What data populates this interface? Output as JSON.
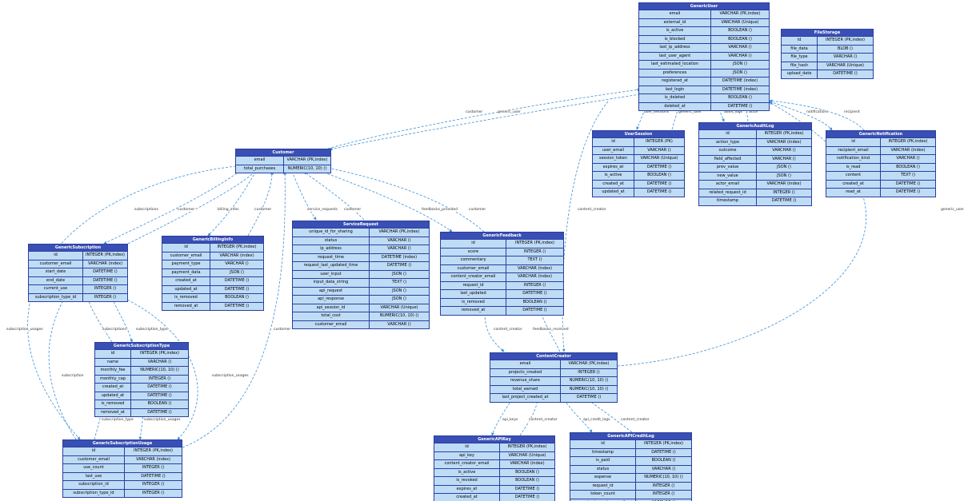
{
  "entities": {
    "GenericUser": {
      "title": "GenericUser",
      "fields": [
        {
          "name": "email",
          "type": "VARCHAR (PK,index)"
        },
        {
          "name": "external_id",
          "type": "VARCHAR (Unique)"
        },
        {
          "name": "is_active",
          "type": "BOOLEAN ()"
        },
        {
          "name": "is_blocked",
          "type": "BOOLEAN ()"
        },
        {
          "name": "last_ip_address",
          "type": "VARCHAR ()"
        },
        {
          "name": "last_user_agent",
          "type": "VARCHAR ()"
        },
        {
          "name": "last_estimated_location",
          "type": "JSON ()"
        },
        {
          "name": "preferences",
          "type": "JSON ()"
        },
        {
          "name": "registered_at",
          "type": "DATETIME (index)"
        },
        {
          "name": "last_login",
          "type": "DATETIME (index)"
        },
        {
          "name": "is_deleted",
          "type": "BOOLEAN ()"
        },
        {
          "name": "deleted_at",
          "type": "DATETIME ()"
        }
      ]
    },
    "FileStorage": {
      "title": "FileStorage",
      "fields": [
        {
          "name": "id",
          "type": "INTEGER (PK,index)"
        },
        {
          "name": "file_data",
          "type": "BLOB ()"
        },
        {
          "name": "file_type",
          "type": "VARCHAR ()"
        },
        {
          "name": "file_hash",
          "type": "VARCHAR (Unique)"
        },
        {
          "name": "upload_date",
          "type": "DATETIME ()"
        }
      ]
    },
    "UserSession": {
      "title": "UserSession",
      "fields": [
        {
          "name": "id",
          "type": "INTEGER (PK)"
        },
        {
          "name": "user_email",
          "type": "VARCHAR ()"
        },
        {
          "name": "session_token",
          "type": "VARCHAR (Unique)"
        },
        {
          "name": "expires_at",
          "type": "DATETIME ()"
        },
        {
          "name": "is_active",
          "type": "BOOLEAN ()"
        },
        {
          "name": "created_at",
          "type": "DATETIME ()"
        },
        {
          "name": "updated_at",
          "type": "DATETIME ()"
        }
      ]
    },
    "GenericAuditLog": {
      "title": "GenericAuditLog",
      "fields": [
        {
          "name": "id",
          "type": "INTEGER (PK,index)"
        },
        {
          "name": "action_type",
          "type": "VARCHAR (index)"
        },
        {
          "name": "outcome",
          "type": "VARCHAR ()"
        },
        {
          "name": "field_affected",
          "type": "VARCHAR ()"
        },
        {
          "name": "prev_value",
          "type": "JSON ()"
        },
        {
          "name": "new_value",
          "type": "JSON ()"
        },
        {
          "name": "actor_email",
          "type": "VARCHAR (index)"
        },
        {
          "name": "related_request_id",
          "type": "INTEGER ()"
        },
        {
          "name": "timestamp",
          "type": "DATETIME ()"
        }
      ]
    },
    "GenericNotification": {
      "title": "GenericNotification",
      "fields": [
        {
          "name": "id",
          "type": "INTEGER (PK,index)"
        },
        {
          "name": "recipient_email",
          "type": "VARCHAR (index)"
        },
        {
          "name": "notification_kind",
          "type": "VARCHAR ()"
        },
        {
          "name": "is_read",
          "type": "BOOLEAN ()"
        },
        {
          "name": "content",
          "type": "TEXT ()"
        },
        {
          "name": "created_at",
          "type": "DATETIME ()"
        },
        {
          "name": "read_at",
          "type": "DATETIME ()"
        }
      ]
    },
    "Customer": {
      "title": "Customer",
      "fields": [
        {
          "name": "email",
          "type": "VARCHAR (PK,index)"
        },
        {
          "name": "total_purchases",
          "type": "NUMERIC(10, 10) ()"
        }
      ]
    },
    "GenericSubscription": {
      "title": "GenericSubscription",
      "fields": [
        {
          "name": "id",
          "type": "INTEGER (PK,index)"
        },
        {
          "name": "customer_email",
          "type": "VARCHAR (index)"
        },
        {
          "name": "start_date",
          "type": "DATETIME ()"
        },
        {
          "name": "end_date",
          "type": "DATETIME ()"
        },
        {
          "name": "current_use",
          "type": "INTEGER ()"
        },
        {
          "name": "subscription_type_id",
          "type": "INTEGER ()"
        }
      ]
    },
    "GenericBillingInfo": {
      "title": "GenericBillingInfo",
      "fields": [
        {
          "name": "id",
          "type": "INTEGER (PK,index)"
        },
        {
          "name": "customer_email",
          "type": "VARCHAR (index)"
        },
        {
          "name": "payment_type",
          "type": "VARCHAR ()"
        },
        {
          "name": "payment_data",
          "type": "JSON ()"
        },
        {
          "name": "created_at",
          "type": "DATETIME ()"
        },
        {
          "name": "updated_at",
          "type": "DATETIME ()"
        },
        {
          "name": "is_removed",
          "type": "BOOLEAN ()"
        },
        {
          "name": "removed_at",
          "type": "DATETIME ()"
        }
      ]
    },
    "ServiceRequest": {
      "title": "ServiceRequest",
      "fields": [
        {
          "name": "unique_id_for_sharing",
          "type": "VARCHAR (PK,index)"
        },
        {
          "name": "status",
          "type": "VARCHAR ()"
        },
        {
          "name": "ip_address",
          "type": "VARCHAR ()"
        },
        {
          "name": "request_time",
          "type": "DATETIME (index)"
        },
        {
          "name": "request_last_updated_time",
          "type": "DATETIME ()"
        },
        {
          "name": "user_input",
          "type": "JSON ()"
        },
        {
          "name": "input_data_string",
          "type": "TEXT ()"
        },
        {
          "name": "api_request",
          "type": "JSON ()"
        },
        {
          "name": "api_response",
          "type": "JSON ()"
        },
        {
          "name": "api_session_id",
          "type": "VARCHAR (Unique)"
        },
        {
          "name": "total_cost",
          "type": "NUMERIC(10, 10) ()"
        },
        {
          "name": "customer_email",
          "type": "VARCHAR ()"
        }
      ]
    },
    "GenericFeedback": {
      "title": "GenericFeedback",
      "fields": [
        {
          "name": "id",
          "type": "INTEGER (PK,index)"
        },
        {
          "name": "score",
          "type": "INTEGER ()"
        },
        {
          "name": "commentary",
          "type": "TEXT ()"
        },
        {
          "name": "customer_email",
          "type": "VARCHAR (index)"
        },
        {
          "name": "content_creator_email",
          "type": "VARCHAR (index)"
        },
        {
          "name": "request_id",
          "type": "INTEGER ()"
        },
        {
          "name": "last_updated",
          "type": "DATETIME ()"
        },
        {
          "name": "is_removed",
          "type": "BOOLEAN ()"
        },
        {
          "name": "removed_at",
          "type": "DATETIME ()"
        }
      ]
    },
    "GenericSubscriptionType": {
      "title": "GenericSubscriptionType",
      "fields": [
        {
          "name": "id",
          "type": "INTEGER (PK,index)"
        },
        {
          "name": "name",
          "type": "VARCHAR ()"
        },
        {
          "name": "monthly_fee",
          "type": "NUMERIC(10, 10) ()"
        },
        {
          "name": "monthly_cap",
          "type": "INTEGER ()"
        },
        {
          "name": "created_at",
          "type": "DATETIME ()"
        },
        {
          "name": "updated_at",
          "type": "DATETIME ()"
        },
        {
          "name": "is_removed",
          "type": "BOOLEAN ()"
        },
        {
          "name": "removed_at",
          "type": "DATETIME ()"
        }
      ]
    },
    "ContentCreator": {
      "title": "ContentCreator",
      "fields": [
        {
          "name": "email",
          "type": "VARCHAR (PK,index)"
        },
        {
          "name": "projects_created",
          "type": "INTEGER ()"
        },
        {
          "name": "revenue_share",
          "type": "NUMERIC(10, 10) ()"
        },
        {
          "name": "total_earned",
          "type": "NUMERIC(10, 10) ()"
        },
        {
          "name": "last_project_created_at",
          "type": "DATETIME ()"
        }
      ]
    },
    "GenericSubscriptionUsage": {
      "title": "GenericSubscriptionUsage",
      "fields": [
        {
          "name": "id",
          "type": "INTEGER (PK,index)"
        },
        {
          "name": "customer_email",
          "type": "VARCHAR (index)"
        },
        {
          "name": "use_count",
          "type": "INTEGER ()"
        },
        {
          "name": "last_use",
          "type": "DATETIME ()"
        },
        {
          "name": "subscription_id",
          "type": "INTEGER ()"
        },
        {
          "name": "subscription_type_id",
          "type": "INTEGER ()"
        }
      ]
    },
    "GenericAPIKey": {
      "title": "GenericAPIKey",
      "fields": [
        {
          "name": "id",
          "type": "INTEGER (PK,index)"
        },
        {
          "name": "api_key",
          "type": "VARCHAR (Unique)"
        },
        {
          "name": "content_creator_email",
          "type": "VARCHAR (index)"
        },
        {
          "name": "is_active",
          "type": "BOOLEAN ()"
        },
        {
          "name": "is_revoked",
          "type": "BOOLEAN ()"
        },
        {
          "name": "expires_at",
          "type": "DATETIME ()"
        },
        {
          "name": "created_at",
          "type": "DATETIME ()"
        }
      ]
    },
    "GenericAPICreditLog": {
      "title": "GenericAPICreditLog",
      "fields": [
        {
          "name": "id",
          "type": "INTEGER (PK,index)"
        },
        {
          "name": "timestamp",
          "type": "DATETIME ()"
        },
        {
          "name": "is_paid",
          "type": "BOOLEAN ()"
        },
        {
          "name": "status",
          "type": "VARCHAR ()"
        },
        {
          "name": "expense",
          "type": "NUMERIC(10, 10) ()"
        },
        {
          "name": "request_id",
          "type": "INTEGER ()"
        },
        {
          "name": "token_count",
          "type": "INTEGER ()"
        },
        {
          "name": "content_creator_email",
          "type": "VARCHAR ()"
        }
      ]
    }
  },
  "relationships": [
    {
      "from": "Customer",
      "to": "GenericUser",
      "label_a": "customer",
      "label_b": "generic_user"
    },
    {
      "from": "GenericUser",
      "to": "UserSession",
      "label_a": "user_sessions",
      "label_b": "generic_user"
    },
    {
      "from": "GenericUser",
      "to": "GenericAuditLog",
      "label_a": "audit_logs",
      "label_b": "actor"
    },
    {
      "from": "GenericUser",
      "to": "GenericNotification",
      "label_a": "notifications",
      "label_b": "recipient"
    },
    {
      "from": "Customer",
      "to": "GenericSubscription",
      "label_a": "subscriptions",
      "label_b": "customer"
    },
    {
      "from": "Customer",
      "to": "GenericBillingInfo",
      "label_a": "billing_infos",
      "label_b": "customer"
    },
    {
      "from": "Customer",
      "to": "ServiceRequest",
      "label_a": "service_requests",
      "label_b": "customer"
    },
    {
      "from": "Customer",
      "to": "GenericFeedback",
      "label_a": "feedbacks_provided",
      "label_b": "customer"
    },
    {
      "from": "Customer",
      "to": "GenericSubscriptionUsage",
      "label_a": "subscription_usages",
      "label_b": "customer"
    },
    {
      "from": "GenericSubscription",
      "to": "GenericSubscriptionType",
      "label_a": "subscriptions",
      "label_b": "subscription_type"
    },
    {
      "from": "GenericSubscription",
      "to": "GenericSubscriptionUsage",
      "label_a": "subscription_usages",
      "label_b": "subscription"
    },
    {
      "from": "GenericSubscriptionType",
      "to": "GenericSubscriptionUsage",
      "label_a": "subscription_type",
      "label_b": "subscription_usages"
    },
    {
      "from": "GenericFeedback",
      "to": "ContentCreator",
      "label_a": "content_creator",
      "label_b": "feedbacks_received"
    },
    {
      "from": "GenericUser",
      "to": "ContentCreator",
      "label_a": "content_creator",
      "label_b": "generic_user"
    },
    {
      "from": "ContentCreator",
      "to": "GenericAPIKey",
      "label_a": "api_keys",
      "label_b": "content_creator"
    },
    {
      "from": "ContentCreator",
      "to": "GenericAPICreditLog",
      "label_a": "api_credit_logs",
      "label_b": "content_creator"
    }
  ],
  "edge_color": "#3b8fd6",
  "header_color": "#3a4fb5",
  "row_color": "#bfdcf6"
}
